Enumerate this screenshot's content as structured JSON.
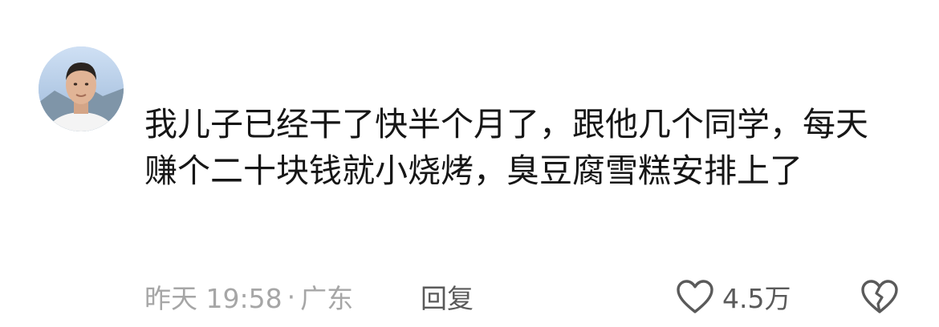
{
  "comment": {
    "username": "",
    "text": "我儿子已经干了快半个月了，跟他几个同学，每天赚个二十块钱就小烧烤，臭豆腐雪糕安排上了",
    "time": "昨天 19:58",
    "location": "广东",
    "separator": "·",
    "reply_label": "回复",
    "like_count": "4.5万",
    "icons": {
      "avatar": "avatar-photo",
      "like": "heart-outline-icon",
      "dislike": "broken-heart-icon"
    },
    "colors": {
      "text": "#161616",
      "meta": "#a6a6a6",
      "action": "#5a5a5a",
      "icon_stroke": "#5a5a5a"
    }
  }
}
